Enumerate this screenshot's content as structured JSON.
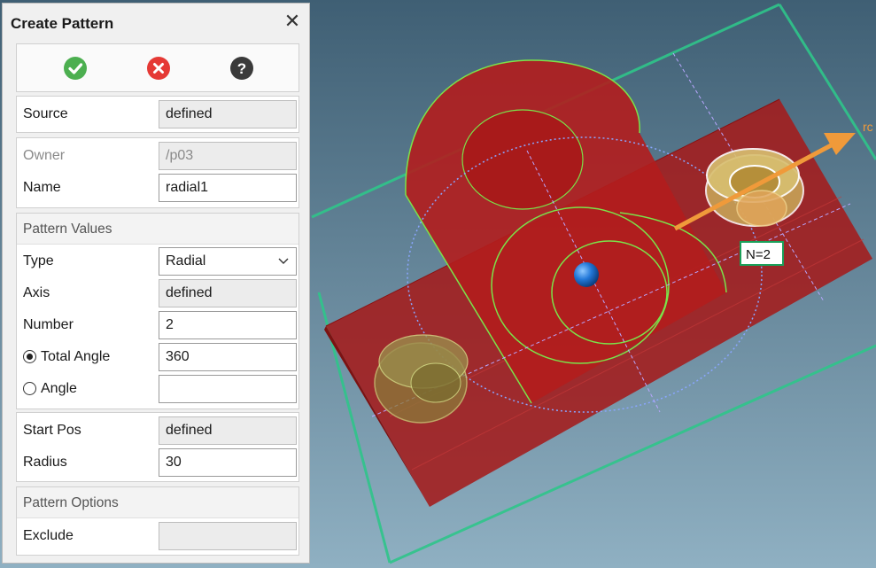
{
  "dialog": {
    "title": "Create Pattern",
    "close_icon": "close-icon",
    "actions": {
      "ok_icon": "check-circle-icon",
      "cancel_icon": "x-circle-icon",
      "help_icon": "question-circle-icon",
      "colors": {
        "ok": "#4caf50",
        "cancel": "#e53935",
        "help": "#3a3a3a"
      }
    },
    "source": {
      "label": "Source",
      "value": "defined"
    },
    "owner": {
      "label": "Owner",
      "value": "/p03"
    },
    "name": {
      "label": "Name",
      "value": "radial1"
    },
    "pattern_values": {
      "heading": "Pattern Values",
      "type": {
        "label": "Type",
        "value": "Radial"
      },
      "axis": {
        "label": "Axis",
        "value": "defined"
      },
      "number": {
        "label": "Number",
        "value": "2"
      },
      "total_angle": {
        "label": "Total Angle",
        "value": "360",
        "selected": true
      },
      "angle": {
        "label": "Angle",
        "value": "",
        "selected": false
      }
    },
    "position": {
      "start_pos": {
        "label": "Start Pos",
        "value": "defined"
      },
      "radius": {
        "label": "Radius",
        "value": "30"
      }
    },
    "pattern_options": {
      "heading": "Pattern Options",
      "exclude": {
        "label": "Exclude",
        "value": ""
      }
    }
  },
  "viewport": {
    "count_label": "N=2",
    "axis_arrow_label": "rc",
    "colors": {
      "background": "#3e5f73",
      "part_red": "#a41b1b",
      "edge_green": "#7be34a",
      "bbox_teal": "#2fc58a",
      "arrow_orange": "#f09a3a",
      "pivot_blue": "#1f6fd0"
    }
  }
}
